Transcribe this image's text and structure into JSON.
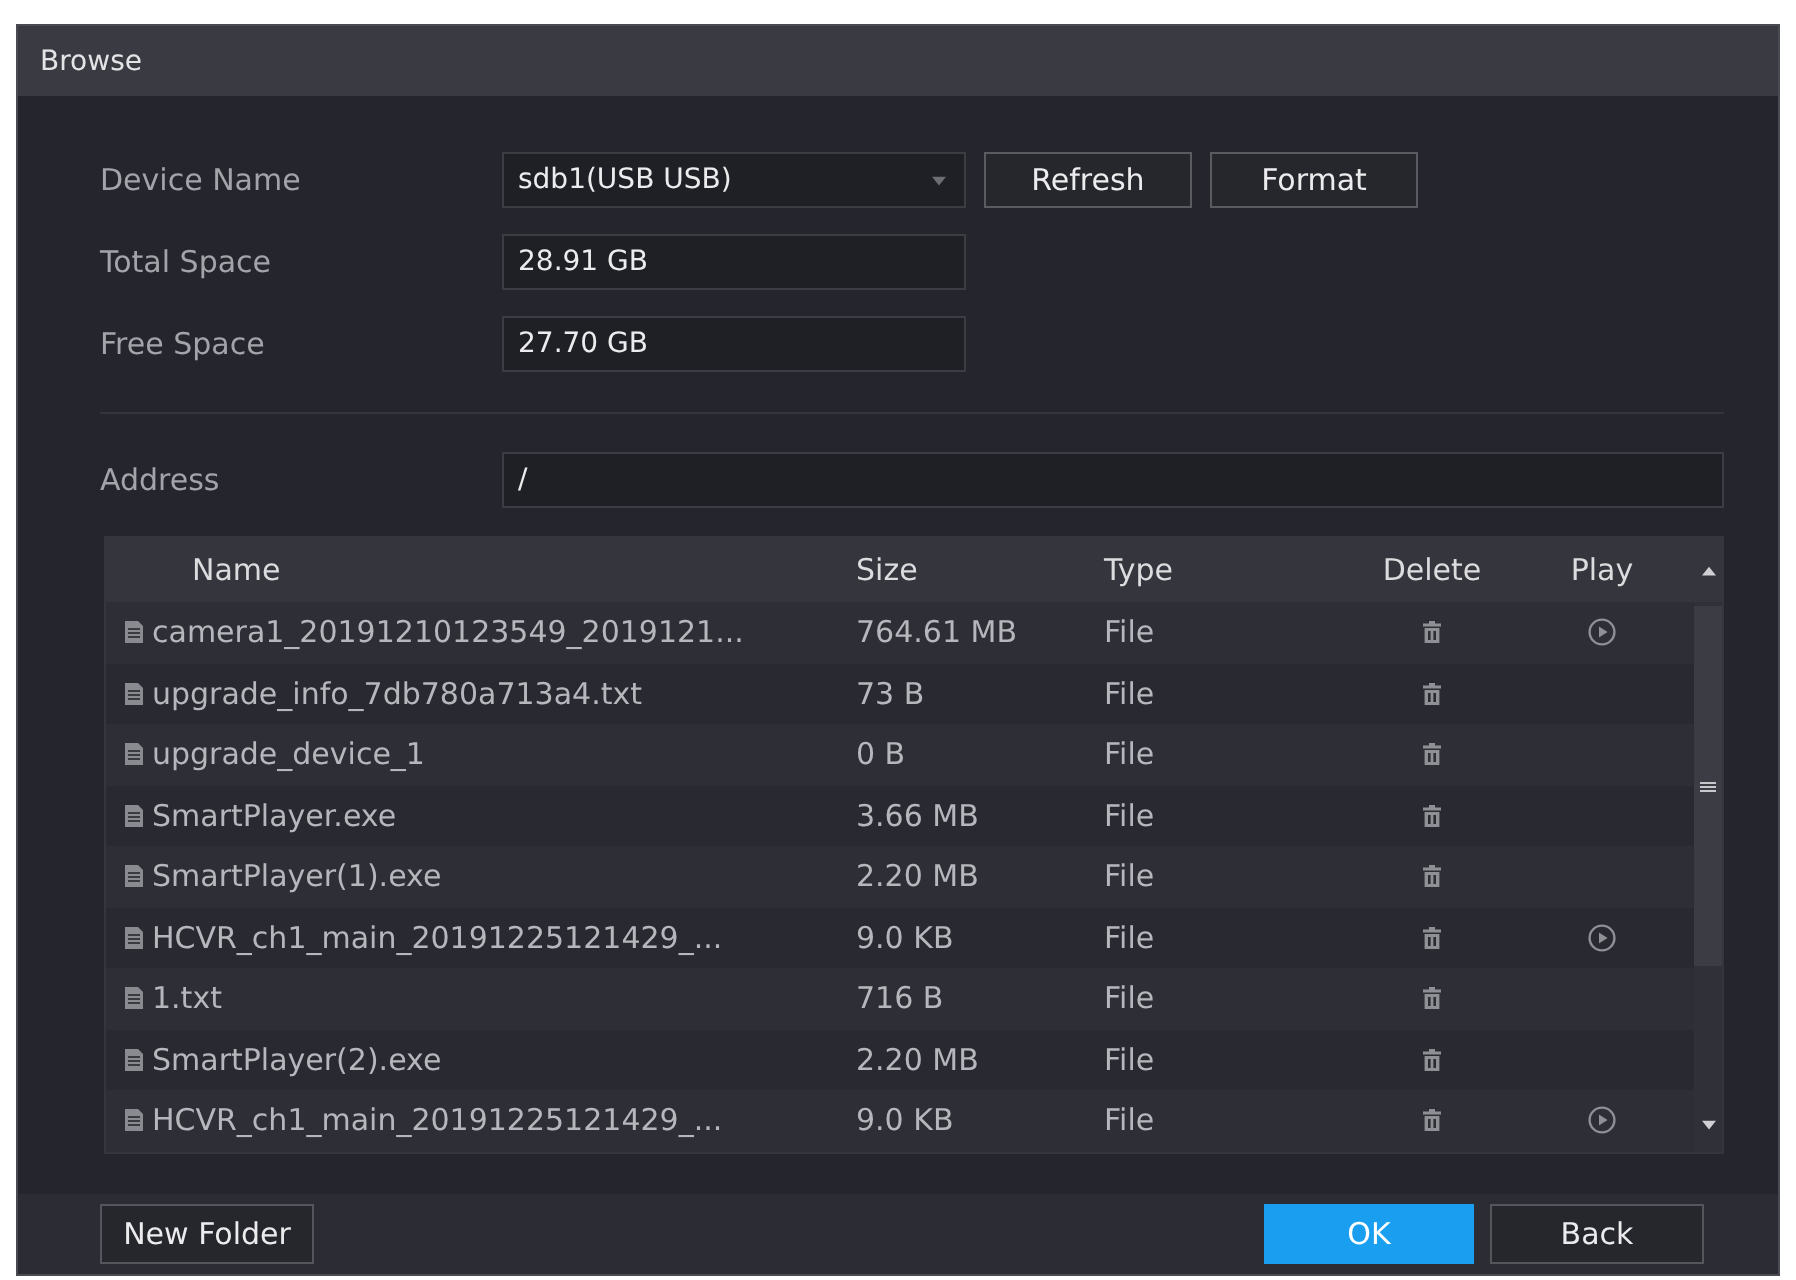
{
  "window": {
    "title": "Browse"
  },
  "device": {
    "label": "Device Name",
    "value": "sdb1(USB USB)"
  },
  "device_buttons": [
    {
      "label": "Refresh"
    },
    {
      "label": "Format"
    }
  ],
  "total_space": {
    "label": "Total Space",
    "value": "28.91 GB"
  },
  "free_space": {
    "label": "Free Space",
    "value": "27.70 GB"
  },
  "address": {
    "label": "Address",
    "value": "/"
  },
  "table": {
    "columns": [
      "Name",
      "Size",
      "Type",
      "Delete",
      "Play"
    ],
    "rows": [
      {
        "name": "camera1_20191210123549_2019121...",
        "size": "764.61 MB",
        "type": "File",
        "playable": true
      },
      {
        "name": "upgrade_info_7db780a713a4.txt",
        "size": "73 B",
        "type": "File",
        "playable": false
      },
      {
        "name": "upgrade_device_1",
        "size": "0 B",
        "type": "File",
        "playable": false
      },
      {
        "name": "SmartPlayer.exe",
        "size": "3.66 MB",
        "type": "File",
        "playable": false
      },
      {
        "name": "SmartPlayer(1).exe",
        "size": "2.20 MB",
        "type": "File",
        "playable": false
      },
      {
        "name": "HCVR_ch1_main_20191225121429_...",
        "size": "9.0 KB",
        "type": "File",
        "playable": true
      },
      {
        "name": "1.txt",
        "size": "716 B",
        "type": "File",
        "playable": false
      },
      {
        "name": "SmartPlayer(2).exe",
        "size": "2.20 MB",
        "type": "File",
        "playable": false
      },
      {
        "name": "HCVR_ch1_main_20191225121429_...",
        "size": "9.0 KB",
        "type": "File",
        "playable": true
      }
    ]
  },
  "footer": {
    "new_folder": "New Folder",
    "actions": [
      {
        "label": "OK",
        "kind": "primary"
      },
      {
        "label": "Back",
        "kind": "secondary"
      }
    ]
  }
}
